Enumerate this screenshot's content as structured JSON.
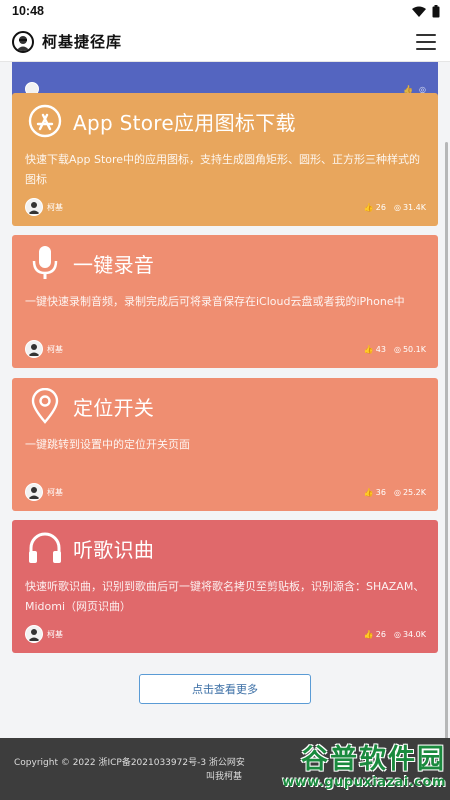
{
  "status_bar": {
    "time": "10:48"
  },
  "header": {
    "site_name": "柯基捷径库"
  },
  "cards": [
    {
      "icon": "app-store-icon",
      "title": "App Store应用图标下载",
      "desc": "快速下载App Store中的应用图标，支持生成圆角矩形、圆形、正方形三种样式的图标",
      "author": "柯基",
      "likes": "26",
      "views": "31.4K",
      "color": "#e8a65d"
    },
    {
      "icon": "microphone-icon",
      "title": "一键录音",
      "desc": "一键快速录制音频，录制完成后可将录音保存在iCloud云盘或者我的iPhone中",
      "author": "柯基",
      "likes": "43",
      "views": "50.1K",
      "color": "#ef8e71"
    },
    {
      "icon": "location-pin-icon",
      "title": "定位开关",
      "desc": "一键跳转到设置中的定位开关页面",
      "author": "柯基",
      "likes": "36",
      "views": "25.2K",
      "color": "#ef8e71"
    },
    {
      "icon": "headphones-icon",
      "title": "听歌识曲",
      "desc": "快速听歌识曲，识别到歌曲后可一键将歌名拷贝至剪贴板，识别源含：SHAZAM、Midomi（网页识曲）",
      "author": "柯基",
      "likes": "26",
      "views": "34.0K",
      "color": "#e0696b"
    }
  ],
  "more_button": "点击查看更多",
  "footer": {
    "line1": "Copyright © 2022 浙ICP备2021033972号-3 浙公网安",
    "line2": "叫我柯基"
  },
  "watermark": {
    "cn": "谷普软件园",
    "en": "www.gupuxiazai.com"
  },
  "colors": {
    "partial_card": "#5465c0",
    "footer_bg": "#3d3d3d",
    "accent": "#5a9bd5"
  }
}
